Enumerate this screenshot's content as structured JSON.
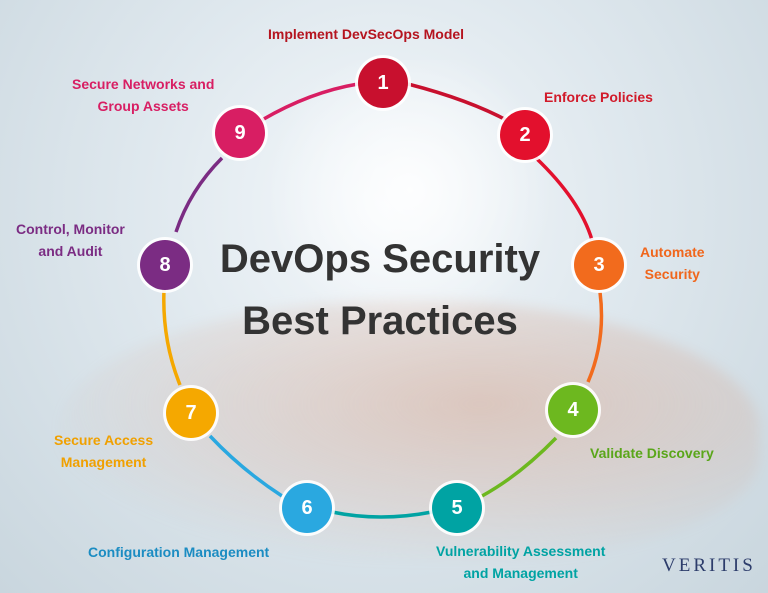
{
  "title_line1": "DevOps Security",
  "title_line2": "Best Practices",
  "logo": "VERITIS",
  "steps": [
    {
      "number": "1",
      "label": "Implement DevSecOps Model",
      "color": "#c8102e"
    },
    {
      "number": "2",
      "label": "Enforce Policies",
      "color": "#e3102d"
    },
    {
      "number": "3",
      "label_lines": [
        "Automate",
        "Security"
      ],
      "color": "#f26b1d"
    },
    {
      "number": "4",
      "label": "Validate Discovery",
      "color": "#6db81f"
    },
    {
      "number": "5",
      "label_lines": [
        "Vulnerability Assessment",
        "and Management"
      ],
      "color": "#00a3a3"
    },
    {
      "number": "6",
      "label": "Configuration Management",
      "color": "#2aa8e0"
    },
    {
      "number": "7",
      "label_lines": [
        "Secure Access",
        "Management"
      ],
      "color": "#f5a800"
    },
    {
      "number": "8",
      "label_lines": [
        "Control, Monitor",
        "and Audit"
      ],
      "color": "#7b2c83"
    },
    {
      "number": "9",
      "label_lines": [
        "Secure Networks and",
        "Group Assets"
      ],
      "color": "#d81e63"
    }
  ]
}
